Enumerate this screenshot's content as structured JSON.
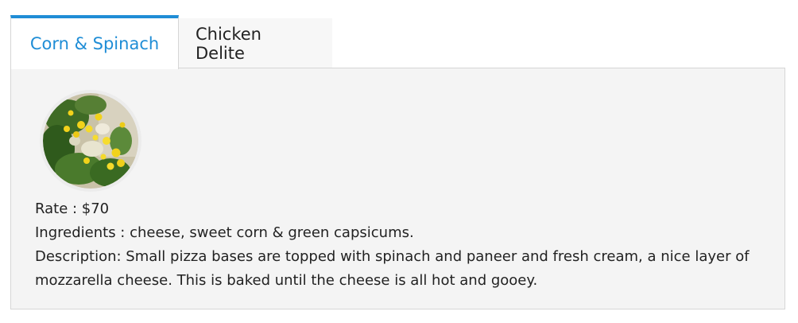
{
  "tabs": [
    {
      "label": "Corn & Spinach",
      "active": true
    },
    {
      "label": "Chicken Delite",
      "active": false
    }
  ],
  "panel": {
    "image_icon": "food-photo",
    "rate": "Rate : $70",
    "ingredients": "Ingredients : cheese, sweet corn & green capsicums.",
    "description": "Description: Small pizza bases are topped with spinach and paneer and fresh cream, a nice layer of mozzarella cheese. This is baked until the cheese is all hot and gooey."
  },
  "colors": {
    "accent": "#1f8dd6",
    "panel_bg": "#f4f4f4",
    "border": "#d6d6d6"
  }
}
